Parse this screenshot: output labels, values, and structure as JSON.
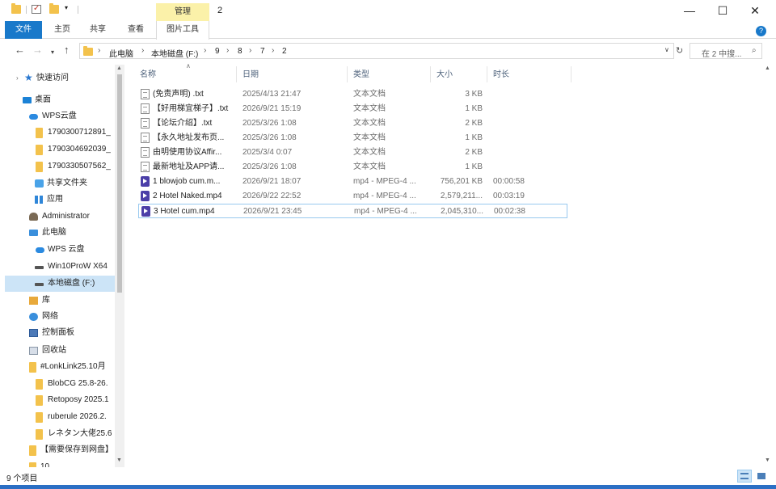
{
  "window": {
    "title": "2",
    "picture_tools_context": "管理",
    "controls": {
      "minimize": "—",
      "maximize": "☐",
      "close": "✕"
    }
  },
  "ribbon": {
    "tabs": [
      {
        "label": "文件",
        "active": true
      },
      {
        "label": "主页"
      },
      {
        "label": "共享"
      },
      {
        "label": "查看"
      },
      {
        "label": "图片工具"
      }
    ],
    "help": "?"
  },
  "address": {
    "breadcrumbs": [
      "此电脑",
      "本地磁盘 (F:)",
      "9",
      "8",
      "7",
      "2"
    ],
    "search_placeholder": "在 2 中搜..."
  },
  "nav_pane": {
    "items": [
      {
        "label": "快速访问",
        "icon": "star-icon"
      },
      {
        "label": "桌面",
        "icon": "desktop-icon"
      },
      {
        "label": "WPS云盘",
        "icon": "cloud-icon"
      },
      {
        "label": "1790300712891_",
        "icon": "folder-icon"
      },
      {
        "label": "1790304692039_",
        "icon": "folder-icon"
      },
      {
        "label": "1790330507562_",
        "icon": "folder-icon"
      },
      {
        "label": "共享文件夹",
        "icon": "shared-folder-icon"
      },
      {
        "label": "应用",
        "icon": "apps-icon"
      },
      {
        "label": "Administrator",
        "icon": "user-icon"
      },
      {
        "label": "此电脑",
        "icon": "pc-icon"
      },
      {
        "label": "WPS 云盘",
        "icon": "cloud-icon"
      },
      {
        "label": "Win10ProW X64",
        "icon": "drive-icon"
      },
      {
        "label": "本地磁盘 (F:)",
        "icon": "drive-icon",
        "selected": true
      },
      {
        "label": "库",
        "icon": "library-icon"
      },
      {
        "label": "网络",
        "icon": "network-icon"
      },
      {
        "label": "控制面板",
        "icon": "control-panel-icon"
      },
      {
        "label": "回收站",
        "icon": "recycle-bin-icon"
      },
      {
        "label": "#LonkLink25.10月",
        "icon": "folder-icon"
      },
      {
        "label": "BlobCG 25.8-26.",
        "icon": "folder-icon"
      },
      {
        "label": "Retoposy 2025.1",
        "icon": "folder-icon"
      },
      {
        "label": "ruberule 2026.2.",
        "icon": "folder-icon"
      },
      {
        "label": "レネタン大佬25.6",
        "icon": "folder-icon"
      },
      {
        "label": "【需要保存到网盘】",
        "icon": "folder-icon"
      },
      {
        "label": "10",
        "icon": "folder-icon"
      }
    ]
  },
  "file_list": {
    "columns": {
      "name": "名称",
      "date": "日期",
      "type": "类型",
      "size": "大小",
      "duration": "时长"
    },
    "rows": [
      {
        "name": "(免责声明) .txt",
        "date": "2025/4/13 21:47",
        "type": "文本文档",
        "size": "3 KB",
        "duration": "",
        "icon": "text-file-icon"
      },
      {
        "name": "【好用梯宜梯子】.txt",
        "date": "2026/9/21 15:19",
        "type": "文本文档",
        "size": "1 KB",
        "duration": "",
        "icon": "text-file-icon"
      },
      {
        "name": "【论坛介绍】.txt",
        "date": "2025/3/26 1:08",
        "type": "文本文档",
        "size": "2 KB",
        "duration": "",
        "icon": "text-file-icon"
      },
      {
        "name": "【永久地址发布页...",
        "date": "2025/3/26 1:08",
        "type": "文本文档",
        "size": "1 KB",
        "duration": "",
        "icon": "text-file-icon"
      },
      {
        "name": "由明使用协议Affir...",
        "date": "2025/3/4 0:07",
        "type": "文本文档",
        "size": "2 KB",
        "duration": "",
        "icon": "text-file-icon"
      },
      {
        "name": "最新地址及APP请...",
        "date": "2025/3/26 1:08",
        "type": "文本文档",
        "size": "1 KB",
        "duration": "",
        "icon": "text-file-icon"
      },
      {
        "name": "1 blowjob cum.m...",
        "date": "2026/9/21 18:07",
        "type": "mp4 - MPEG-4 ...",
        "size": "756,201 KB",
        "duration": "00:00:58",
        "icon": "video-file-icon"
      },
      {
        "name": "2 Hotel Naked.mp4",
        "date": "2026/9/22 22:52",
        "type": "mp4 - MPEG-4 ...",
        "size": "2,579,211...",
        "duration": "00:03:19",
        "icon": "video-file-icon"
      },
      {
        "name": "3 Hotel cum.mp4",
        "date": "2026/9/21 23:45",
        "type": "mp4 - MPEG-4 ...",
        "size": "2,045,310...",
        "duration": "00:02:38",
        "icon": "video-file-icon",
        "focused": true
      }
    ]
  },
  "status": {
    "item_count": "9 个项目"
  },
  "colors": {
    "accent": "#1979ca",
    "context_tab": "#fbf1a9",
    "selection": "#cce4f7",
    "taskbar": "#2b6fc4"
  }
}
